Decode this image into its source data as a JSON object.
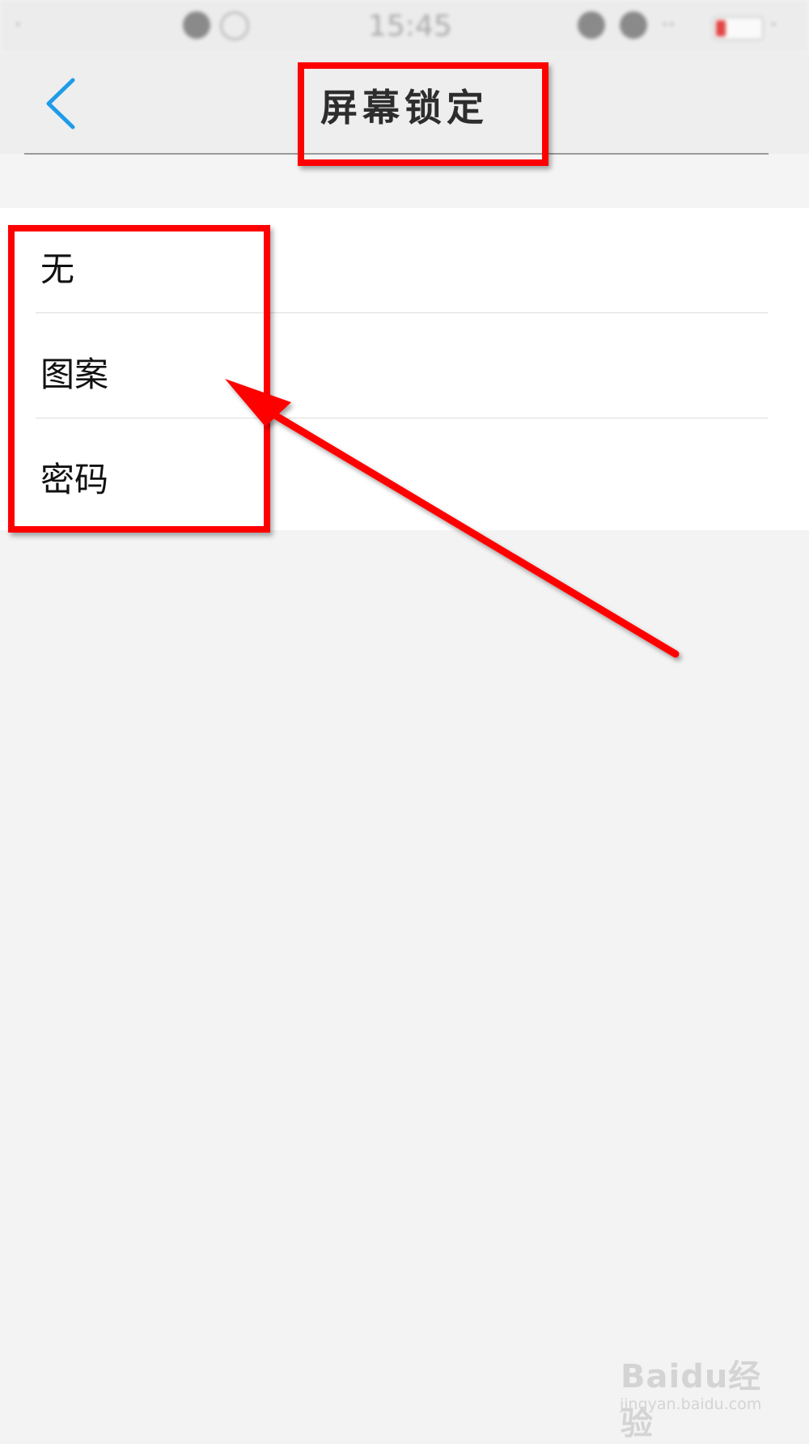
{
  "status_bar": {
    "carrier_text": "·",
    "time": "15:45",
    "right_text": "··",
    "end_text": "·"
  },
  "header": {
    "back_icon": "chevron-left-icon",
    "title": "屏幕锁定"
  },
  "options": [
    {
      "label": "无"
    },
    {
      "label": "图案"
    },
    {
      "label": "密码"
    }
  ],
  "colors": {
    "accent": "#1e9be9",
    "annotation": "#ff0000",
    "list_background": "#ffffff",
    "page_background": "#f3f3f3"
  },
  "watermark": {
    "brand": "Baidu经验",
    "url": "jingyan.baidu.com"
  }
}
